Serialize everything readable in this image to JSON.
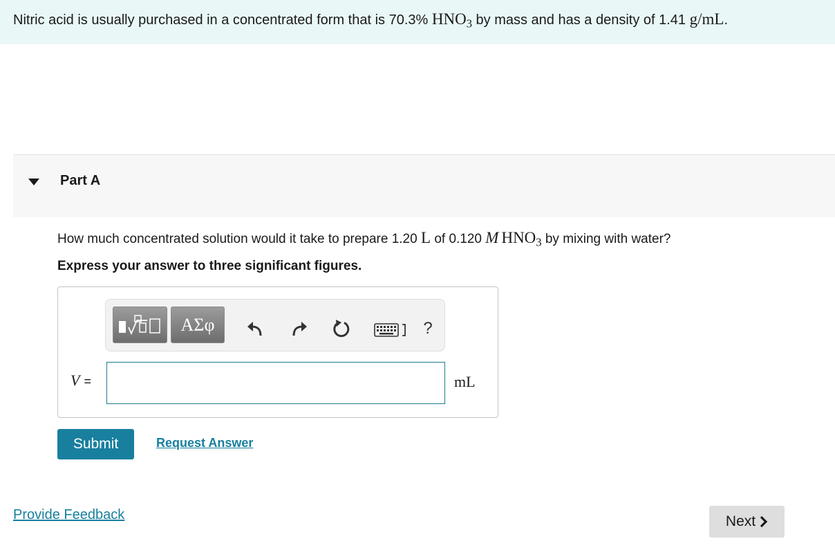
{
  "intro": {
    "text_1": "Nitric acid is usually purchased in a concentrated form that is 70.3% ",
    "formula_base": "HNO",
    "formula_sub": "3",
    "text_2": " by mass and has a density of 1.41 ",
    "density_unit": "g/mL",
    "text_3": "."
  },
  "part": {
    "title": "Part A",
    "expanded": true
  },
  "question": {
    "text_1": "How much concentrated solution would it take to prepare 1.20 ",
    "volume_unit": "L",
    "text_2": " of 0.120 ",
    "molarity_symbol": "M",
    "formula_base": "HNO",
    "formula_sub": "3",
    "text_3": " by mixing with water?"
  },
  "instruction": "Express your answer to three significant figures.",
  "toolbar": {
    "greek_label": "ΑΣφ",
    "help_label": "?",
    "icons": [
      "templates-icon",
      "undo-icon",
      "redo-icon",
      "reset-icon",
      "keyboard-icon",
      "help-icon"
    ]
  },
  "answer": {
    "variable": "V",
    "equals": "=",
    "value": "",
    "unit": "mL"
  },
  "actions": {
    "submit_label": "Submit",
    "request_answer_label": "Request Answer",
    "feedback_label": "Provide Feedback",
    "next_label": "Next"
  },
  "colors": {
    "accent": "#187f9f",
    "intro_background": "#e9f7f7",
    "part_header_background": "#f7f7f7",
    "next_button_background": "#dedede"
  }
}
